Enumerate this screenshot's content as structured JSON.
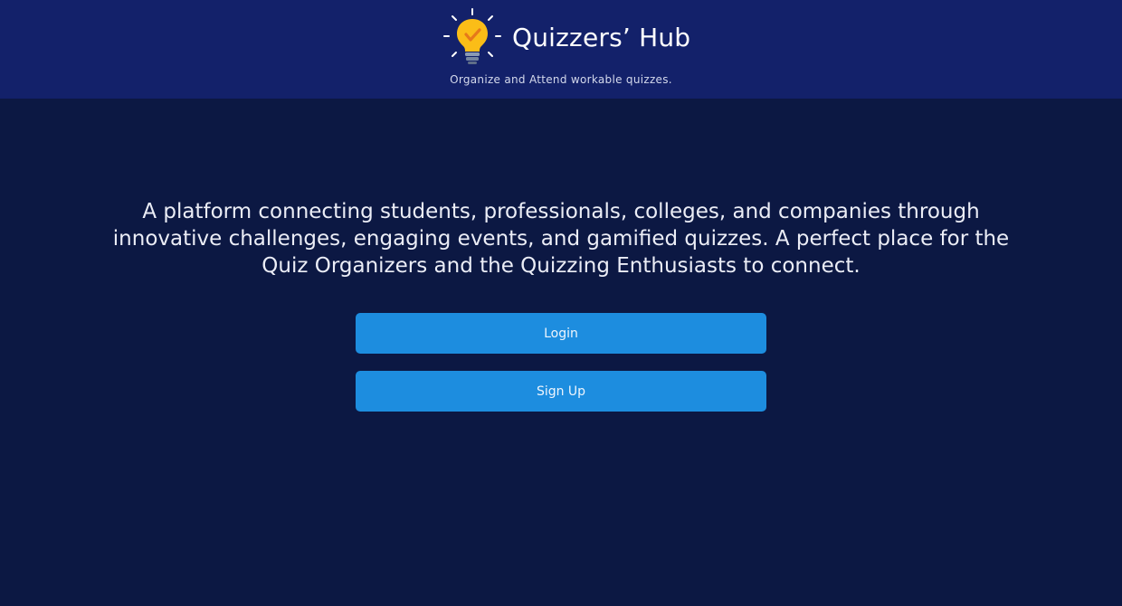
{
  "header": {
    "title": "Quizzers’ Hub",
    "tagline": "Organize and Attend workable quizzes.",
    "logo_icon": "lightbulb-check-icon",
    "background_color": "#13216a"
  },
  "main": {
    "description": "A platform connecting students, professionals, colleges, and companies through innovative challenges, engaging events, and gamified quizzes. A perfect place for the Quiz Organizers and the Quizzing Enthusiasts to connect.",
    "background_color": "#0c1843"
  },
  "actions": {
    "login_label": "Login",
    "signup_label": "Sign Up",
    "button_color": "#1d8ddf"
  }
}
